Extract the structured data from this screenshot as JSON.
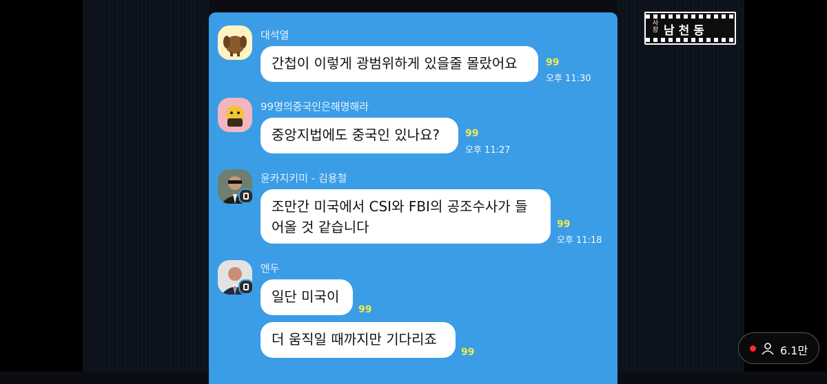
{
  "messages": [
    {
      "sender": "대석열",
      "text": "간첩이 이렇게 광범위하게 있을줄 몰랐어요",
      "count": "99",
      "time": "오후 11:30"
    },
    {
      "sender": "99명의중국인은해명해라",
      "text": "중앙지법에도 중국인 있나요?",
      "count": "99",
      "time": "오후 11:27"
    },
    {
      "sender": "윤카지키미 - 김용철",
      "text_line1": "조만간 미국에서 CSI와 FBI의 공조수사가 들",
      "text_line2": "어올 것 같습니다",
      "count": "99",
      "time": "오후 11:18"
    },
    {
      "sender": "엔두",
      "text": "일단 미국이",
      "count": "99"
    },
    {
      "text": "더 움직일 때까지만 기다리죠",
      "count": "99"
    }
  ],
  "logo": {
    "small_top": "사",
    "small_bottom": "장",
    "title": "남천동"
  },
  "live": {
    "viewers": "6.1만"
  },
  "colors": {
    "chat_bg": "#3a9de6",
    "unread": "#f2e94e",
    "bubble": "#ffffff"
  }
}
